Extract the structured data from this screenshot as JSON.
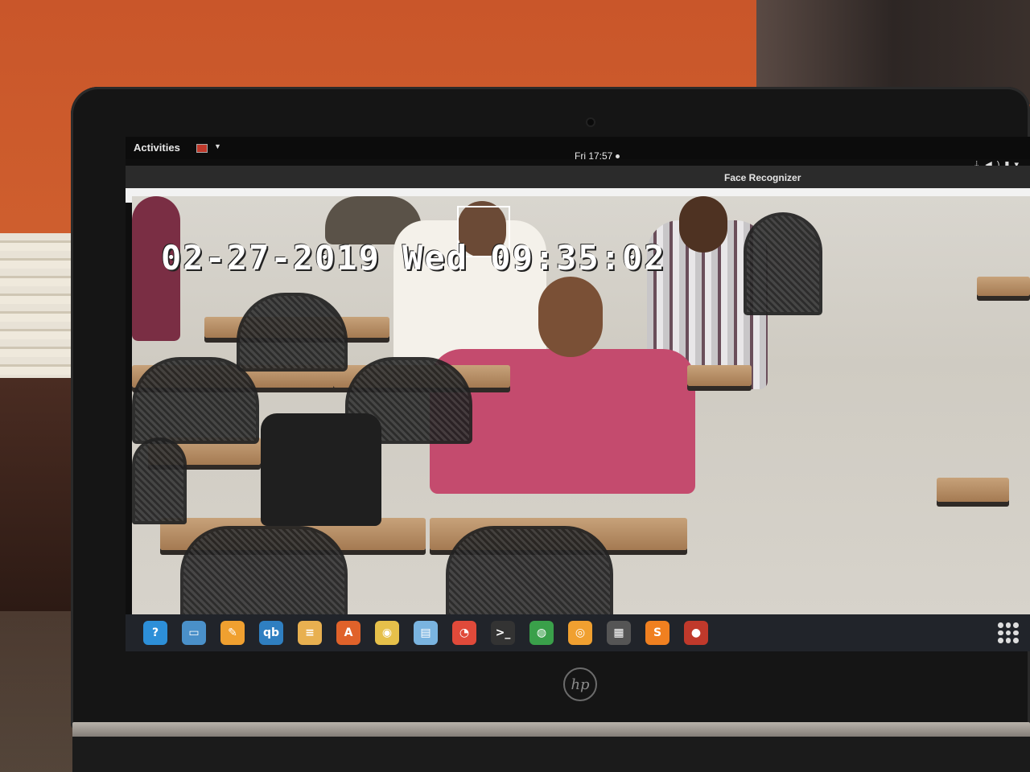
{
  "topbar": {
    "activities_label": "Activities",
    "clock": "Fri 17:57",
    "tray_icons": [
      "network-icon",
      "volume-icon",
      "battery-icon",
      "power-menu-icon"
    ]
  },
  "window": {
    "title": "Face Recognizer"
  },
  "video": {
    "timestamp_overlay": "02-27-2019 Wed 09:35:02",
    "face_label": "",
    "colors": {
      "overlay_text": "#ffffff",
      "face_box": "#ffffff"
    }
  },
  "dock": {
    "items": [
      {
        "icon": "help-icon",
        "glyph": "?",
        "color": "#2d8fd8"
      },
      {
        "icon": "files-icon",
        "glyph": "▭",
        "color": "#4a90c9"
      },
      {
        "icon": "text-editor-icon",
        "glyph": "✎",
        "color": "#f0a030"
      },
      {
        "icon": "qbittorrent-icon",
        "glyph": "qb",
        "color": "#2f7fc1"
      },
      {
        "icon": "notes-icon",
        "glyph": "≡",
        "color": "#e8b050"
      },
      {
        "icon": "software-center-icon",
        "glyph": "A",
        "color": "#e0622a"
      },
      {
        "icon": "image-viewer-icon",
        "glyph": "◉",
        "color": "#e6c04a"
      },
      {
        "icon": "document-viewer-icon",
        "glyph": "▤",
        "color": "#7ab4e0"
      },
      {
        "icon": "screenshot-icon",
        "glyph": "◔",
        "color": "#e04a3a"
      },
      {
        "icon": "terminal-icon",
        "glyph": ">_",
        "color": "#333333"
      },
      {
        "icon": "chrome-icon",
        "glyph": "◍",
        "color": "#3aa04a"
      },
      {
        "icon": "disk-icon",
        "glyph": "◎",
        "color": "#f0a030"
      },
      {
        "icon": "video-editor-icon",
        "glyph": "▦",
        "color": "#555555"
      },
      {
        "icon": "sublime-text-icon",
        "glyph": "S",
        "color": "#f08020"
      },
      {
        "icon": "face-recognizer-app-icon",
        "glyph": "●",
        "color": "#c0392b"
      }
    ]
  },
  "hardware": {
    "brand_logo": "hp"
  }
}
